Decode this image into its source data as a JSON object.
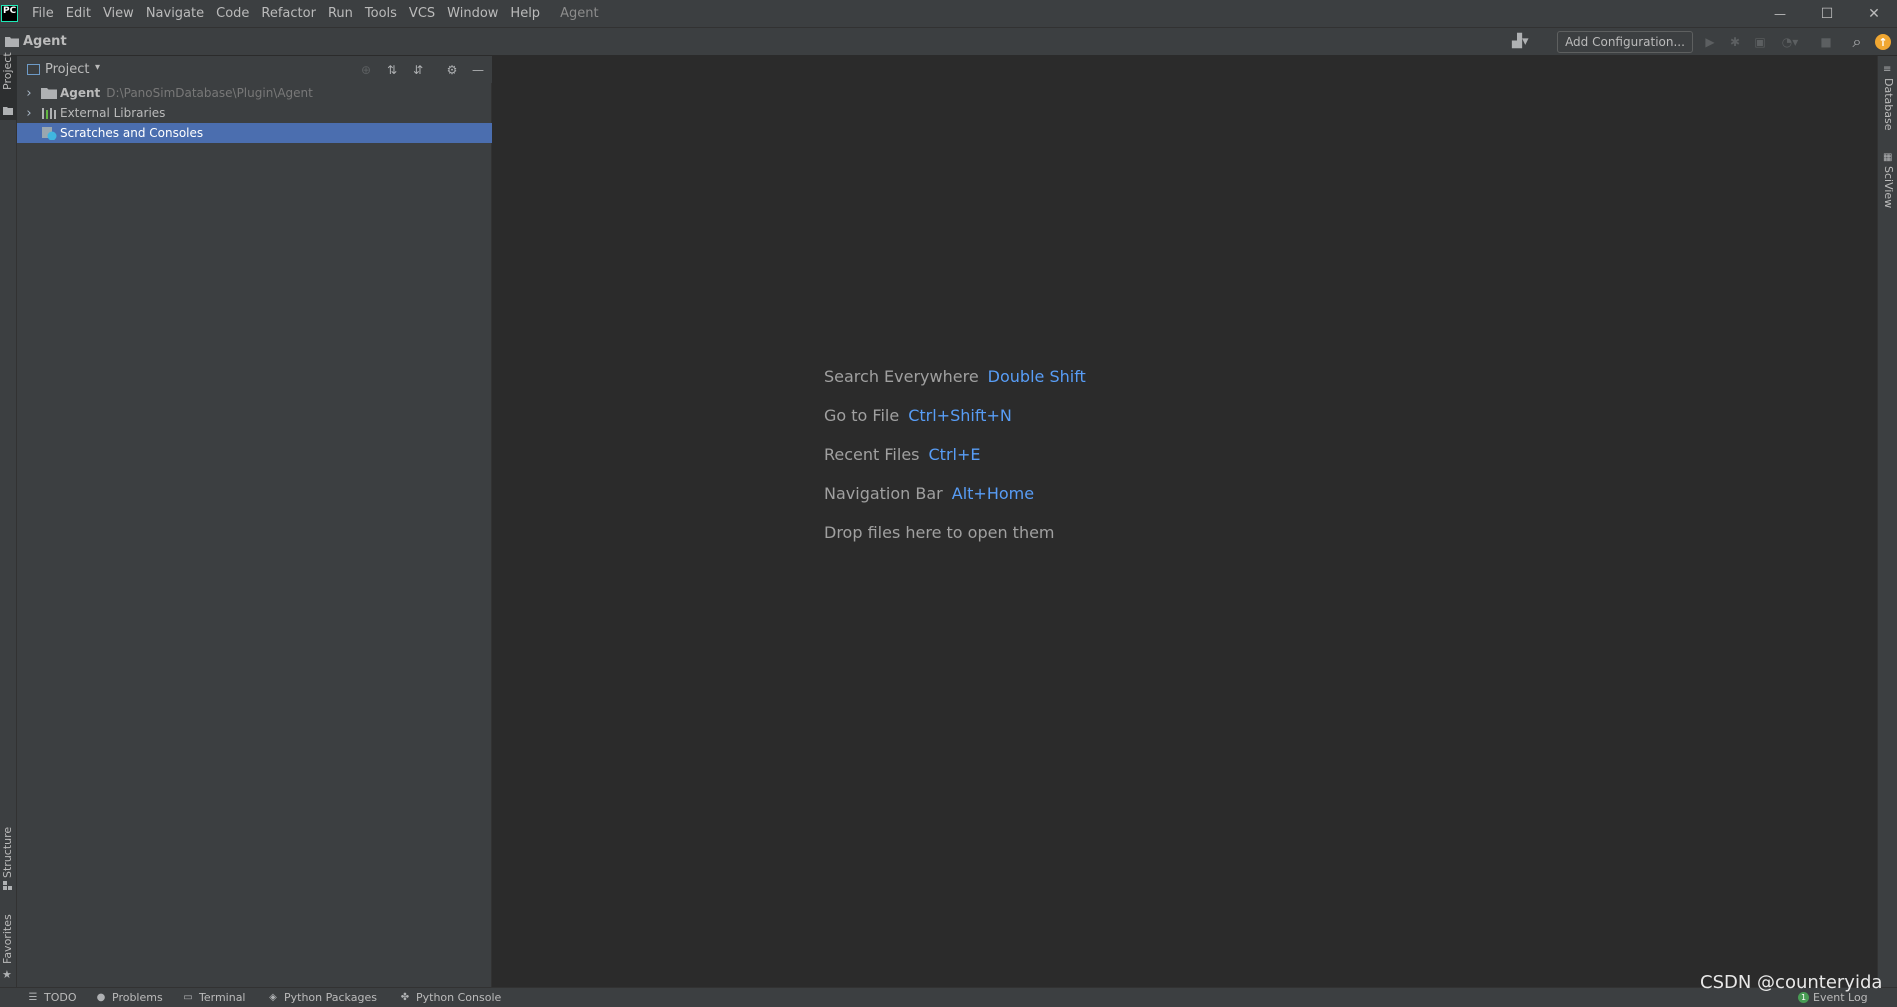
{
  "app": {
    "logo_text": "PC",
    "window_title": "Agent"
  },
  "menu": {
    "items": [
      "File",
      "Edit",
      "View",
      "Navigate",
      "Code",
      "Refactor",
      "Run",
      "Tools",
      "VCS",
      "Window",
      "Help"
    ]
  },
  "window_controls": {
    "minimize": "—",
    "maximize": "☐",
    "close": "✕"
  },
  "navbar": {
    "breadcrumb": "Agent",
    "add_configuration": "Add Configuration...",
    "user_icon": "▟▾",
    "run_icon": "▶",
    "debug_icon": "✱",
    "coverage_icon": "▣",
    "profile_icon": "◔▾",
    "stop_icon": "■",
    "search_icon": "⌕",
    "update_icon": "↑"
  },
  "left_strip": {
    "project_tab": "Project",
    "structure_tab": "Structure",
    "favorites_tab": "Favorites"
  },
  "project_panel": {
    "title": "Project",
    "chevron": "▾",
    "tools": {
      "locate": "⊕",
      "expand_all": "⇅",
      "collapse_all": "⇵",
      "settings": "⚙",
      "hide": "—"
    },
    "tree": [
      {
        "arrow": "›",
        "name": "Agent",
        "path": "D:\\PanoSimDatabase\\Plugin\\Agent"
      },
      {
        "arrow": "›",
        "name": "External Libraries"
      },
      {
        "arrow": "",
        "name": "Scratches and Consoles"
      }
    ]
  },
  "editor": {
    "hints": [
      {
        "label": "Search Everywhere",
        "key": "Double Shift"
      },
      {
        "label": "Go to File",
        "key": "Ctrl+Shift+N"
      },
      {
        "label": "Recent Files",
        "key": "Ctrl+E"
      },
      {
        "label": "Navigation Bar",
        "key": "Alt+Home"
      },
      {
        "label": "Drop files here to open them",
        "key": ""
      }
    ]
  },
  "right_strip": {
    "database_tab": "Database",
    "sciview_tab": "SciView"
  },
  "bottom_bar": {
    "tabs": [
      {
        "icon": "☰",
        "label": "TODO"
      },
      {
        "icon": "●",
        "label": "Problems"
      },
      {
        "icon": "▭",
        "label": "Terminal"
      },
      {
        "icon": "◈",
        "label": "Python Packages"
      },
      {
        "icon": "✤",
        "label": "Python Console"
      }
    ],
    "event_log": {
      "badge": "1",
      "label": "Event Log"
    }
  },
  "watermark": "CSDN @counteryida"
}
